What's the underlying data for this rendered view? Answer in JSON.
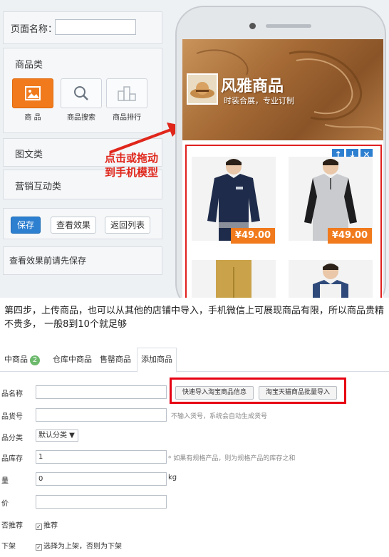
{
  "editor": {
    "page_name_label": "页面名称：",
    "page_name_value": "",
    "categories": {
      "goods": "商品类",
      "text_image": "图文类",
      "marketing": "营销互动类"
    },
    "tiles": [
      {
        "label": "商 品",
        "icon": "image-icon",
        "active": true
      },
      {
        "label": "商品搜索",
        "icon": "search-icon",
        "active": false
      },
      {
        "label": "商品排行",
        "icon": "ranking-icon",
        "active": false
      }
    ],
    "buttons": {
      "save": "保存",
      "preview": "查看效果",
      "back": "返回列表"
    },
    "hint": "查看效果前请先保存",
    "annotation_line1": "点击或拖动",
    "annotation_line2": "到手机模型",
    "colors": {
      "accent": "#f07a1c",
      "primary": "#2d7fd0",
      "annotation": "#e0261b"
    }
  },
  "phone": {
    "shop_name": "风雅商品",
    "shop_slogan": "时装合展，专业订制",
    "controls": [
      "↑",
      "↓",
      "✕"
    ],
    "products": [
      {
        "price": "¥49.00"
      },
      {
        "price": "¥49.00"
      }
    ]
  },
  "instruction": "第四步，上传商品，也可以从其他的店铺中导入，手机微信上可展现商品有限，所以商品贵精不贵多， 一般8到10个就足够",
  "product_form": {
    "tabs": [
      {
        "label": "中商品",
        "badge": "2"
      },
      {
        "label": "仓库中商品"
      },
      {
        "label": "售罄商品"
      }
    ],
    "active_tab": "添加商品",
    "fields": {
      "name_label": "品名称",
      "sku_label": "品货号",
      "sku_hint": "不输入货号，系统会自动生成货号",
      "category_label": "品分类",
      "category_value": "默认分类 ▼",
      "stock_label": "品库存",
      "stock_value": "1",
      "stock_hint": "* 如果有规格产品，则为规格产品的库存之和",
      "weight_label": "量",
      "weight_value": "0",
      "weight_unit": "kg",
      "price_label": "价",
      "recommend_label": "否推荐",
      "recommend_check": "推荐",
      "shelf_label": "下架",
      "shelf_check": "选择为上架，否则为下架"
    },
    "import_buttons": {
      "quick": "快速导入淘宝商品信息",
      "batch": "淘宝天猫商品批量导入"
    }
  }
}
